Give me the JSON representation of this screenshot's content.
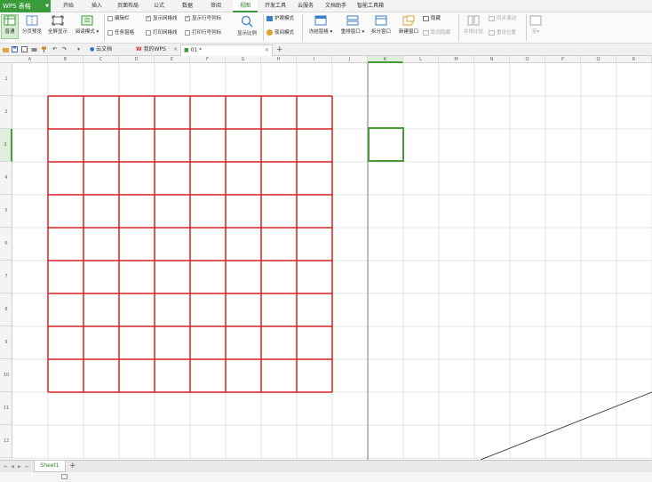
{
  "app": {
    "name": "WPS 表格",
    "accent": "#3a9b3a"
  },
  "menu": {
    "items": [
      "开始",
      "插入",
      "页面布局",
      "公式",
      "数据",
      "审阅",
      "视图",
      "开发工具",
      "云服务",
      "文档助手",
      "智能工具箱"
    ],
    "active": "视图"
  },
  "ribbon": {
    "normal": "普通",
    "page_break": "分页预览",
    "fullscreen": "全屏显示",
    "reading": "阅读模式",
    "cb_editbar": "编辑栏",
    "cb_taskpane": "任务窗格",
    "cb_show_grid": "显示网格线",
    "cb_print_grid": "打印网格线",
    "cb_show_headers": "显示行号列标",
    "cb_print_headers": "打印行号列标",
    "zoom": "显示比例",
    "eye_mode": "护眼模式",
    "night_mode": "夜间模式",
    "freeze": "冻结窗格",
    "rearrange": "重排窗口",
    "split": "拆分窗口",
    "new_window": "新建窗口",
    "hide": "隐藏",
    "unhide": "取消隐藏",
    "side_by_side": "并排比较",
    "sync_scroll": "同步滚动",
    "reset_pos": "重设位置",
    "macro": "宏"
  },
  "tabs": {
    "cloud": "云文档",
    "mywps": "我的WPS",
    "file": "01 *"
  },
  "columns": [
    "A",
    "B",
    "C",
    "D",
    "E",
    "F",
    "G",
    "H",
    "I",
    "J",
    "K",
    "L",
    "M",
    "N",
    "O",
    "P",
    "Q",
    "R"
  ],
  "rows": [
    "1",
    "2",
    "3",
    "4",
    "5",
    "6",
    "7",
    "8",
    "9",
    "10",
    "11",
    "12"
  ],
  "table_color": "#d62020",
  "selection_color": "#4a9a3a",
  "sheets": [
    "Sheet1"
  ]
}
